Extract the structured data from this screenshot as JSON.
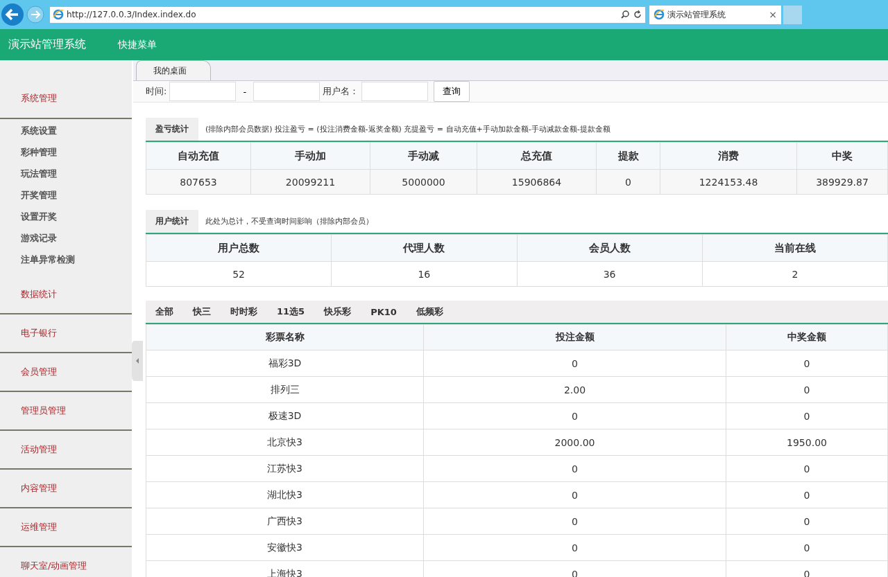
{
  "browser": {
    "url": "http://127.0.0.3/Index.index.do",
    "tab_title": "演示站管理系统",
    "tab_close": "×"
  },
  "header": {
    "title": "演示站管理系统",
    "menu": "快捷菜单"
  },
  "sidebar": {
    "items": [
      {
        "label": "系统管理",
        "children": [
          {
            "label": "系统设置"
          },
          {
            "label": "彩种管理"
          },
          {
            "label": "玩法管理"
          },
          {
            "label": "开奖管理"
          },
          {
            "label": "设置开奖"
          },
          {
            "label": "游戏记录"
          },
          {
            "label": "注单异常检测"
          }
        ]
      },
      {
        "label": "数据统计"
      },
      {
        "label": "电子银行"
      },
      {
        "label": "会员管理"
      },
      {
        "label": "管理员管理"
      },
      {
        "label": "活动管理"
      },
      {
        "label": "内容管理"
      },
      {
        "label": "运维管理"
      },
      {
        "label": "聊天室/动画管理"
      }
    ]
  },
  "tabs": [
    {
      "label": "我的桌面"
    }
  ],
  "query": {
    "time_label": "时间:",
    "separator": "-",
    "user_label": "用户名：",
    "button": "查询"
  },
  "profit": {
    "title": "盈亏统计",
    "note": "(排除内部会员数据)  投注盈亏 = (投注消费金额-返奖金额)    充提盈亏 = 自动充值+手动加款金额-手动减款金额-提款金额",
    "columns": [
      "自动充值",
      "手动加",
      "手动减",
      "总充值",
      "提款",
      "消费",
      "中奖"
    ],
    "values": [
      "807653",
      "20099211",
      "5000000",
      "15906864",
      "0",
      "1224153.48",
      "389929.87"
    ]
  },
  "users": {
    "title": "用户统计",
    "note": "此处为总计，不受查询时间影响（排除内部会员）",
    "columns": [
      "用户总数",
      "代理人数",
      "会员人数",
      "当前在线"
    ],
    "values": [
      "52",
      "16",
      "36",
      "2"
    ]
  },
  "lottery_tabs": [
    {
      "label": "全部"
    },
    {
      "label": "快三"
    },
    {
      "label": "时时彩"
    },
    {
      "label": "11选5"
    },
    {
      "label": "快乐彩"
    },
    {
      "label": "PK10"
    },
    {
      "label": "低频彩"
    }
  ],
  "lottery": {
    "columns": [
      "彩票名称",
      "投注金额",
      "中奖金额"
    ],
    "rows": [
      [
        "福彩3D",
        "0",
        "0"
      ],
      [
        "排列三",
        "2.00",
        "0"
      ],
      [
        "极速3D",
        "0",
        "0"
      ],
      [
        "北京快3",
        "2000.00",
        "1950.00"
      ],
      [
        "江苏快3",
        "0",
        "0"
      ],
      [
        "湖北快3",
        "0",
        "0"
      ],
      [
        "广西快3",
        "0",
        "0"
      ],
      [
        "安徽快3",
        "0",
        "0"
      ],
      [
        "上海快3",
        "0",
        "0"
      ]
    ]
  }
}
